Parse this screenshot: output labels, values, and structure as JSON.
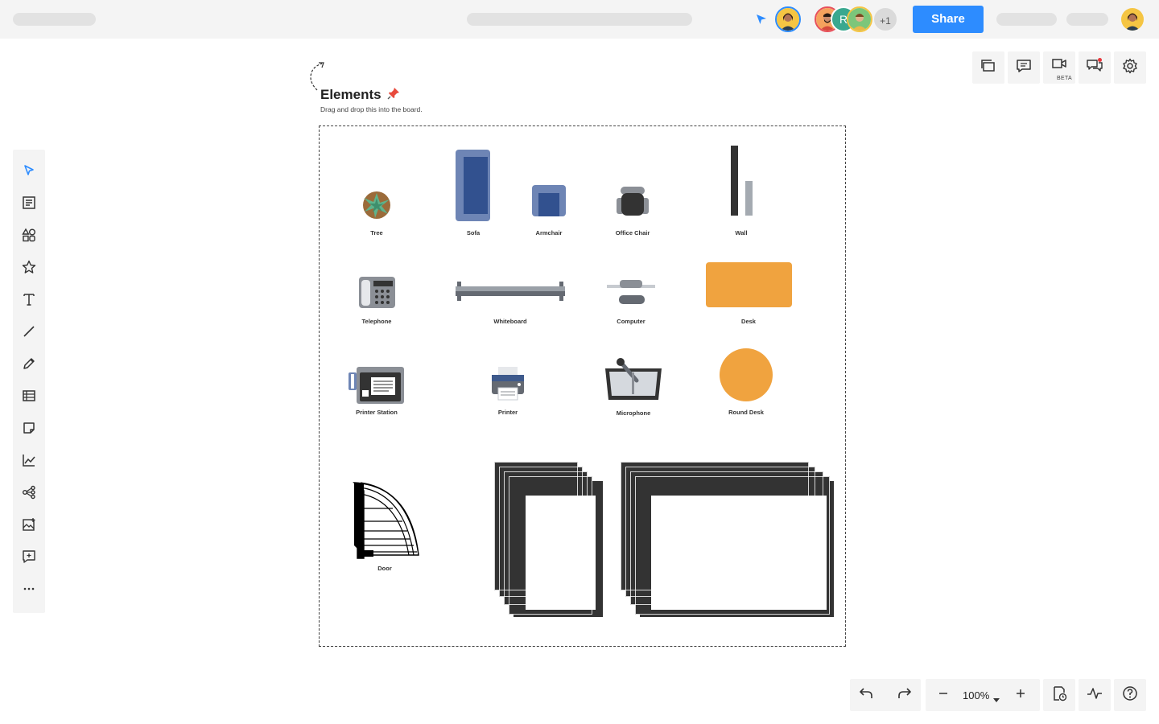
{
  "header": {
    "share_label": "Share",
    "collaborators_extra": "+1",
    "collaborator_initial": "R"
  },
  "toolbar": {
    "tools": [
      "select-tool",
      "template-tool",
      "shapes-tool",
      "icons-tool",
      "text-tool",
      "line-tool",
      "pen-tool",
      "table-tool",
      "sticky-note-tool",
      "chart-tool",
      "mind-map-tool",
      "image-tool",
      "comment-tool",
      "more-tool"
    ]
  },
  "right_panel": {
    "beta_label": "BETA"
  },
  "board": {
    "title": "Elements",
    "subtitle": "Drag and drop this into the board.",
    "elements": {
      "tree": "Tree",
      "sofa": "Sofa",
      "armchair": "Armchair",
      "office_chair": "Office Chair",
      "wall": "Wall",
      "telephone": "Telephone",
      "whiteboard": "Whiteboard",
      "computer": "Computer",
      "desk": "Desk",
      "printer_station": "Printer Station",
      "printer": "Printer",
      "microphone": "Microphone",
      "round_desk": "Round Desk",
      "door": "Door"
    }
  },
  "bottom_bar": {
    "zoom": "100%"
  },
  "colors": {
    "accent": "#2d8cff",
    "desk": "#f0a33f",
    "sofa": "#3b5998",
    "dark": "#333333"
  }
}
